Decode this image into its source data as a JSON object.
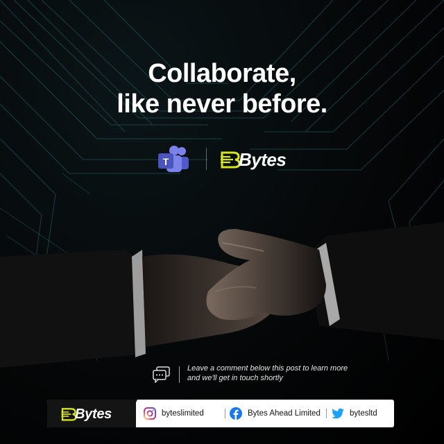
{
  "headline": {
    "line1": "Collaborate,",
    "line2": "like never before."
  },
  "logos": {
    "teams_icon": "microsoft-teams-icon",
    "brand_name": "Bytes"
  },
  "cta": {
    "icon": "chat-bubbles-icon",
    "text": "Leave a comment below this post to learn more and we'll get in touch shortly"
  },
  "footer": {
    "brand_name": "Bytes",
    "instagram": {
      "icon": "instagram-icon",
      "handle": "byteslimited"
    },
    "facebook": {
      "icon": "facebook-icon",
      "handle": "Bytes Ahead Limited"
    },
    "twitter": {
      "icon": "twitter-icon",
      "handle": "bytesltd"
    }
  },
  "colors": {
    "background": "#000000",
    "brand_accent": "#d7e51f",
    "teams_purple": "#5059c9",
    "facebook_blue": "#1877f2",
    "twitter_blue": "#1da1f2"
  }
}
